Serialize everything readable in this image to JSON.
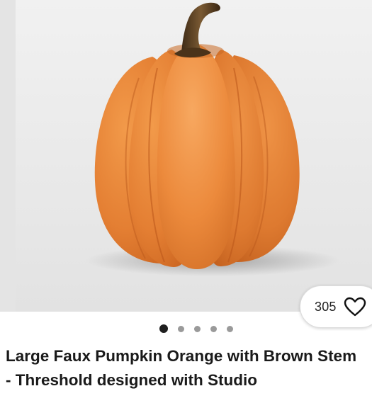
{
  "product": {
    "image_alt": "Large faux pumpkin, orange with brown stem",
    "favorites_count": "305",
    "title": "Large Faux Pumpkin Orange with Brown Stem - Threshold designed with Studio"
  },
  "carousel": {
    "total_images": 5,
    "active_index": 0
  },
  "icons": {
    "favorite": "heart-outline-icon"
  },
  "colors": {
    "pumpkin": "#e8843a",
    "stem": "#5a3f22",
    "background": "#ececec",
    "active_dot": "#1f1f1f",
    "inactive_dot": "#9a9a9a"
  }
}
